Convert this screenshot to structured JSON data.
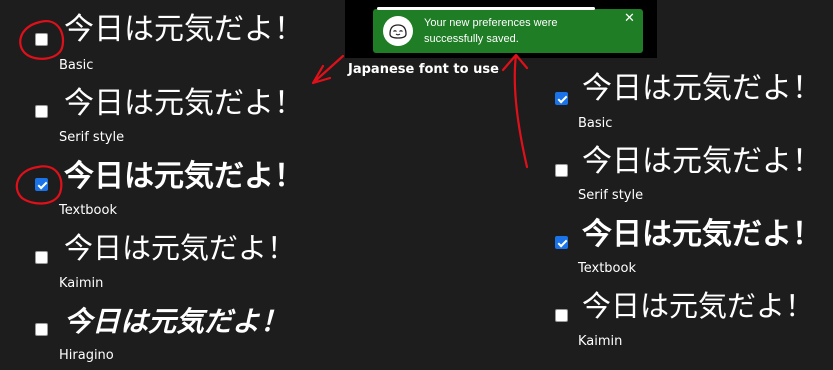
{
  "heading": "Japanese font to use",
  "sample_text": "今日は元気だよ！",
  "left_options": [
    {
      "label": "Basic",
      "checked": false
    },
    {
      "label": "Serif style",
      "checked": false
    },
    {
      "label": "Textbook",
      "checked": true
    },
    {
      "label": "Kaimin",
      "checked": false
    },
    {
      "label": "Hiragino",
      "checked": false
    }
  ],
  "right_options": [
    {
      "label": "Basic",
      "checked": true
    },
    {
      "label": "Serif style",
      "checked": false
    },
    {
      "label": "Textbook",
      "checked": true
    },
    {
      "label": "Kaimin",
      "checked": false
    }
  ],
  "toast": {
    "message": "Your new preferences were successfully saved.",
    "close_glyph": "✕",
    "icon": "smiling-mascot-icon",
    "progress": 0.8
  },
  "colors": {
    "background": "#1d1d1d",
    "toast": "#1e7d25",
    "checkbox_checked": "#1a73e8",
    "annotation": "#e0101a"
  }
}
